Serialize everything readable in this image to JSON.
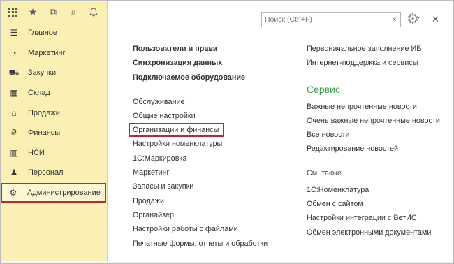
{
  "search": {
    "placeholder": "Поиск (Ctrl+F)",
    "clear": "×"
  },
  "topbar": {
    "icons": [
      "apps-grid-icon",
      "star-icon",
      "history-icon",
      "search-icon",
      "bell-icon"
    ],
    "star_glyph": "★",
    "history_glyph": "⧉",
    "search_glyph": "⌕",
    "bell_glyph": "♫"
  },
  "sidebar": {
    "items": [
      {
        "label": "Главное",
        "icon": "☰"
      },
      {
        "label": "Маркетинг",
        "icon": "◔"
      },
      {
        "label": "Закупки",
        "icon": "⛟"
      },
      {
        "label": "Склад",
        "icon": "▦"
      },
      {
        "label": "Продажи",
        "icon": "⌂"
      },
      {
        "label": "Финансы",
        "icon": "₽"
      },
      {
        "label": "НСИ",
        "icon": "▥"
      },
      {
        "label": "Персонал",
        "icon": "♟"
      },
      {
        "label": "Администрирование",
        "icon": "⚙",
        "active": true
      }
    ]
  },
  "header": {
    "gear_glyph": "⚙",
    "caret": "▾",
    "close": "✕"
  },
  "left_column": {
    "bold_links": [
      "Пользователи и права",
      "Синхронизация данных",
      "Подключаемое оборудование"
    ],
    "links": [
      "Обслуживание",
      "Общие настройки",
      "Организации и финансы",
      "Настройки номенклатуры",
      "1С:Маркировка",
      "Маркетинг",
      "Запасы и закупки",
      "Продажи",
      "Органайзер",
      "Настройки работы с файлами",
      "Печатные формы, отчеты и обработки"
    ]
  },
  "right_column": {
    "top_links": [
      "Первоначальное заполнение ИБ",
      "Интернет-поддержка и сервисы"
    ],
    "service_title": "Сервис",
    "service_links": [
      "Важные непрочтенные новости",
      "Очень важные непрочтенные новости",
      "Все новости",
      "Редактирование новостей"
    ],
    "see_also_title": "См. также",
    "see_also_links": [
      "1С:Номенклатура",
      "Обмен с сайтом",
      "Настройки интеграции с ВетИС",
      "Обмен электронными документами"
    ]
  },
  "colors": {
    "sidebar_bg": "#fbf0b3",
    "highlight_border": "#c0272d",
    "section_title": "#3ca34b"
  }
}
